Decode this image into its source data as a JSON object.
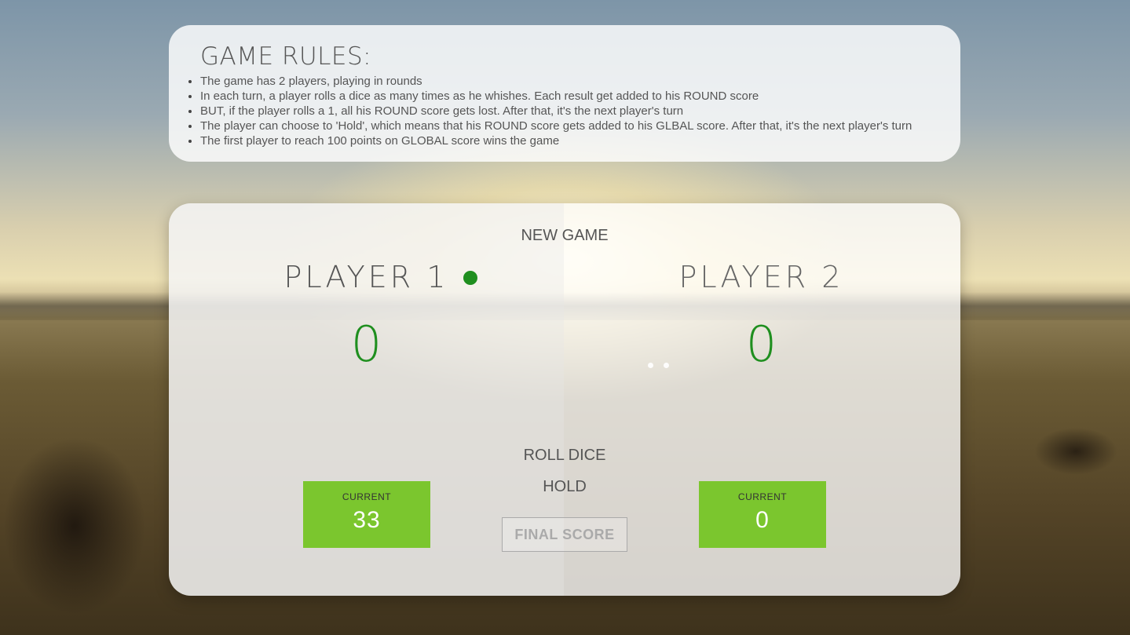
{
  "rules": {
    "title": "GAME RULES:",
    "items": [
      "The game has 2 players, playing in rounds",
      "In each turn, a player rolls a dice as many times as he whishes. Each result get added to his ROUND score",
      "BUT, if the player rolls a 1, all his ROUND score gets lost. After that, it's the next player's turn",
      "The player can choose to 'Hold', which means that his ROUND score gets added to his GLBAL score. After that, it's the next player's turn",
      "The first player to reach 100 points on GLOBAL score wins the game"
    ]
  },
  "controls": {
    "new_game": "NEW GAME",
    "roll_dice": "ROLL DICE",
    "hold": "HOLD",
    "final_score_placeholder": "FINAL SCORE"
  },
  "players": [
    {
      "name": "PLAYER 1",
      "global_score": "0",
      "current_label": "CURRENT",
      "current_score": "33",
      "active": true
    },
    {
      "name": "PLAYER 2",
      "global_score": "0",
      "current_label": "CURRENT",
      "current_score": "0",
      "active": false
    }
  ],
  "colors": {
    "accent_green": "#1f8f1f",
    "current_box": "#7bc62e",
    "text": "#555555"
  },
  "icons": {
    "active_player": "active-player-dot-icon"
  }
}
